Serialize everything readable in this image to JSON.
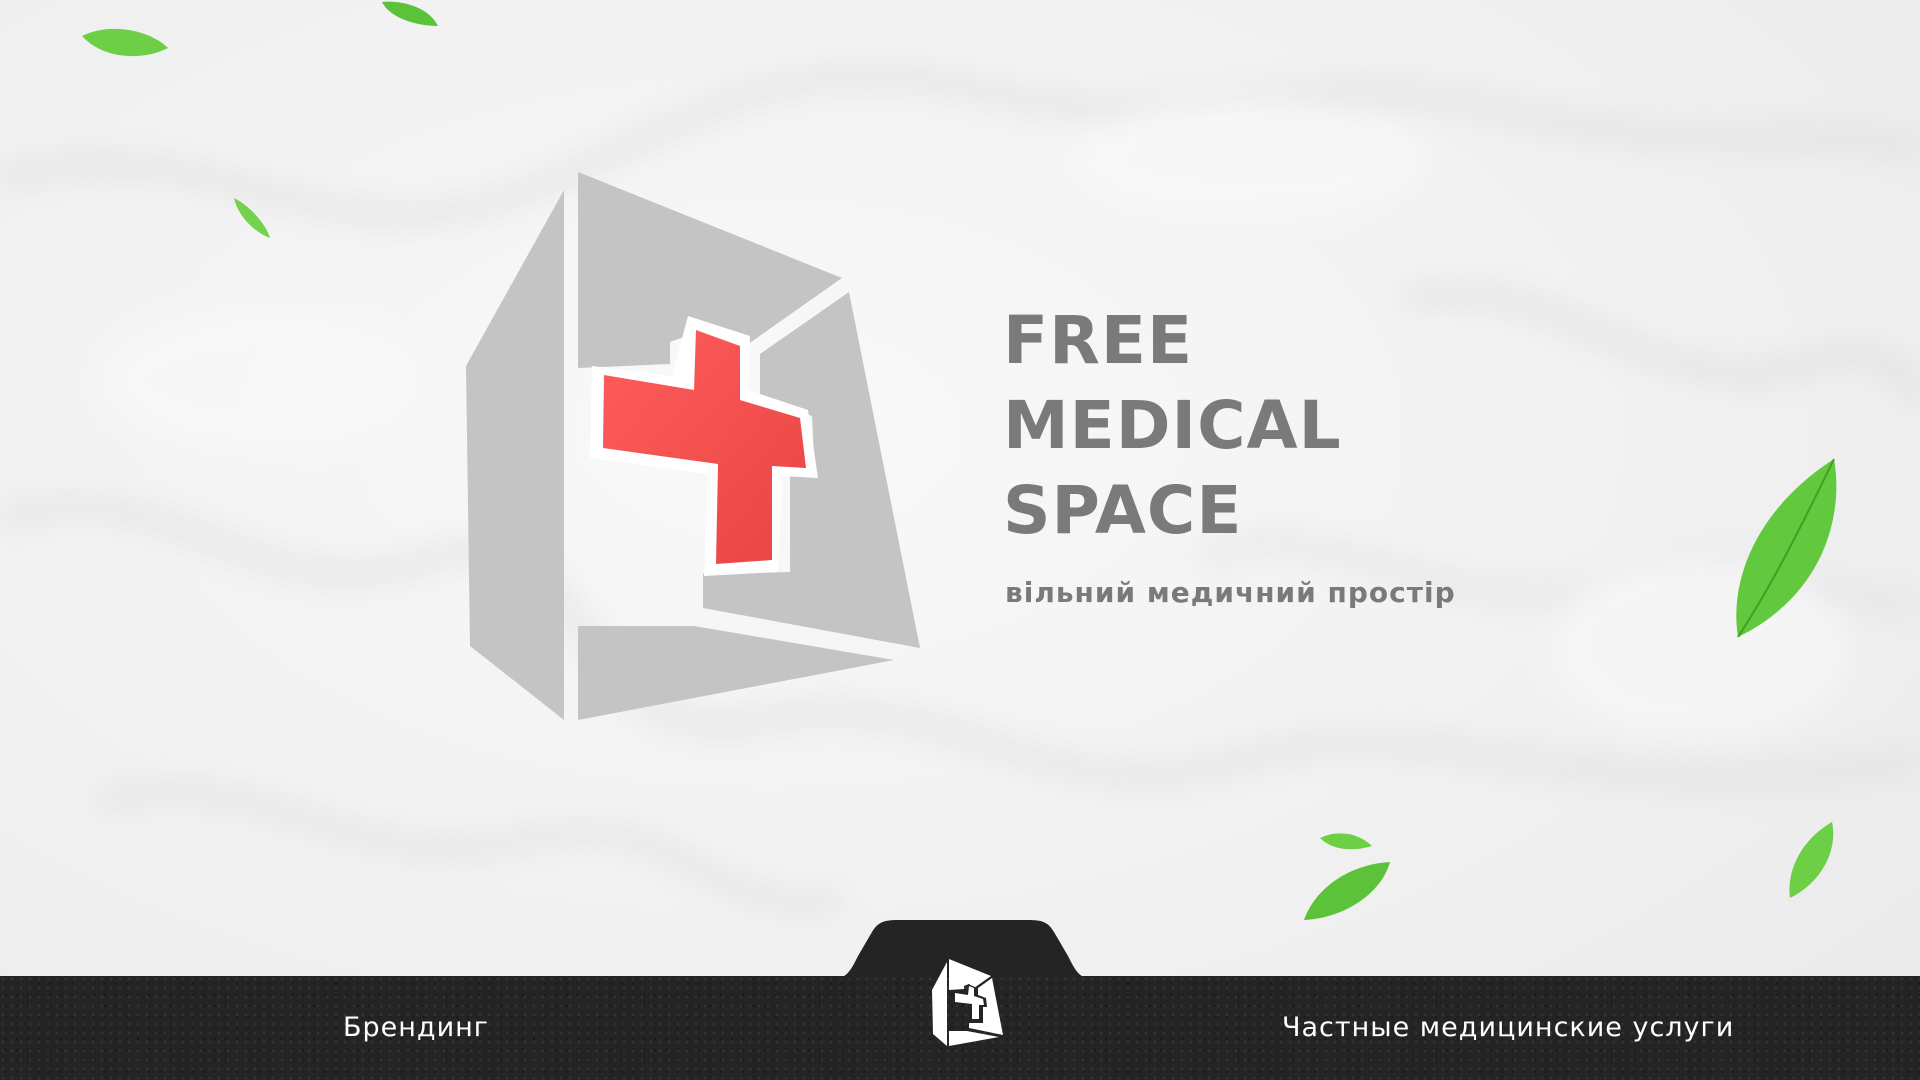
{
  "brand": {
    "title_lines": [
      "FREE",
      "MEDICAL",
      "SPACE"
    ],
    "subtitle": "вільний медичний простір"
  },
  "footer": {
    "left_label": "Брендинг",
    "right_label": "Частные медицинские услуги"
  },
  "icons": {
    "logo": "medical-cross-box-logo",
    "footer_logo": "medical-cross-box-logo-white",
    "leaves": "leaf-icon"
  },
  "colors": {
    "background": "#f2f2f2",
    "logo_gray": "#c4c4c4",
    "cross_red": "#ee4444",
    "text_gray": "#7a7a7a",
    "footer_bar": "#242424",
    "leaf_green": "#5cc23a",
    "footer_text": "#ffffff"
  }
}
